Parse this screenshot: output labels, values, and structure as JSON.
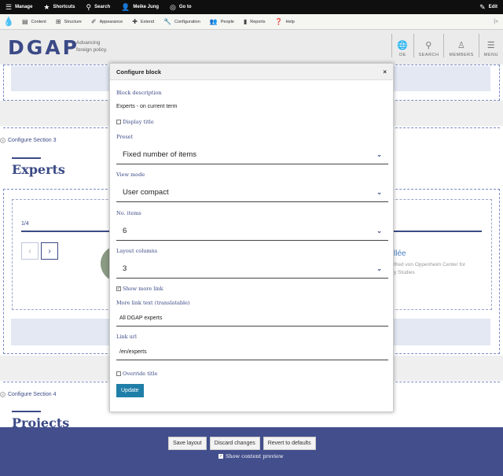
{
  "toolbar": {
    "manage": "Manage",
    "shortcuts": "Shortcuts",
    "search": "Search",
    "user": "Meike Jung",
    "goto": "Go to",
    "edit": "Edit"
  },
  "tray": {
    "items": [
      "Content",
      "Structure",
      "Appearance",
      "Extend",
      "Configuration",
      "People",
      "Reports",
      "Help"
    ],
    "collapse": "|»"
  },
  "site": {
    "logo": "DGAP",
    "tagline_line1": "Advancing",
    "tagline_line2": "foreign policy.",
    "nav": [
      {
        "label": "DE",
        "icon": "globe-icon"
      },
      {
        "label": "SEARCH",
        "icon": "search-icon"
      },
      {
        "label": "MEMBERS",
        "icon": "user-icon"
      },
      {
        "label": "MENU",
        "icon": "menu-icon"
      }
    ]
  },
  "page": {
    "section3_label": "Configure Section 3",
    "experts_heading": "Experts",
    "pager_count": "1/4",
    "expert_name": "llée",
    "expert_org_line1": "lfred von Oppenheim Center for",
    "expert_org_line2": "y Studies",
    "section4_label": "Configure Section 4",
    "projects_heading": "Projects"
  },
  "dialog": {
    "title": "Configure block",
    "close": "×",
    "block_description_label": "Block description",
    "block_description_value": "Experts - on current term",
    "display_title_label": "Display title",
    "preset_label": "Preset",
    "preset_value": "Fixed number of items",
    "view_mode_label": "View mode",
    "view_mode_value": "User compact",
    "no_items_label": "No. items",
    "no_items_value": "6",
    "layout_columns_label": "Layout columns",
    "layout_columns_value": "3",
    "show_more_link_label": "Show more link",
    "more_link_text_label": "More link text (translatable)",
    "more_link_text_value": "All DGAP experts",
    "link_url_label": "Link url",
    "link_url_value": "/en/experts",
    "override_title_label": "Override title",
    "update_button": "Update"
  },
  "bottom": {
    "save_layout": "Save layout",
    "discard_changes": "Discard changes",
    "revert_defaults": "Revert to defaults",
    "show_preview": "Show content preview"
  },
  "colors": {
    "brand": "#3b4a86",
    "bottom_bar": "#434f8c",
    "update_button": "#1f7fa8"
  }
}
